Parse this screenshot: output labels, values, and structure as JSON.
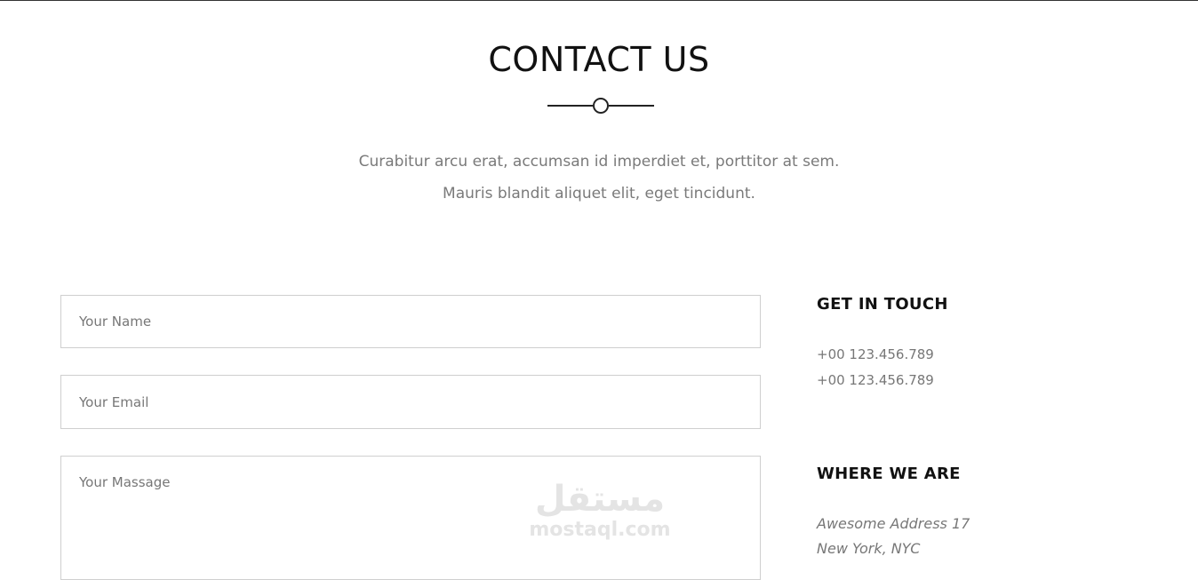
{
  "header": {
    "title": "CONTACT US",
    "intro_line1": "Curabitur arcu erat, accumsan id imperdiet et, porttitor at sem.",
    "intro_line2": "Mauris blandit aliquet elit, eget tincidunt."
  },
  "form": {
    "name_placeholder": "Your Name",
    "email_placeholder": "Your Email",
    "message_placeholder": "Your Massage"
  },
  "sidebar": {
    "touch_title": "GET IN TOUCH",
    "phones": [
      "+00 123.456.789",
      "+00 123.456.789"
    ],
    "where_title": "WHERE WE ARE",
    "address_lines": [
      "Awesome Address 17",
      "New York, NYC"
    ]
  },
  "watermark": {
    "arabic": "مستقل",
    "latin": "mostaql.com"
  }
}
